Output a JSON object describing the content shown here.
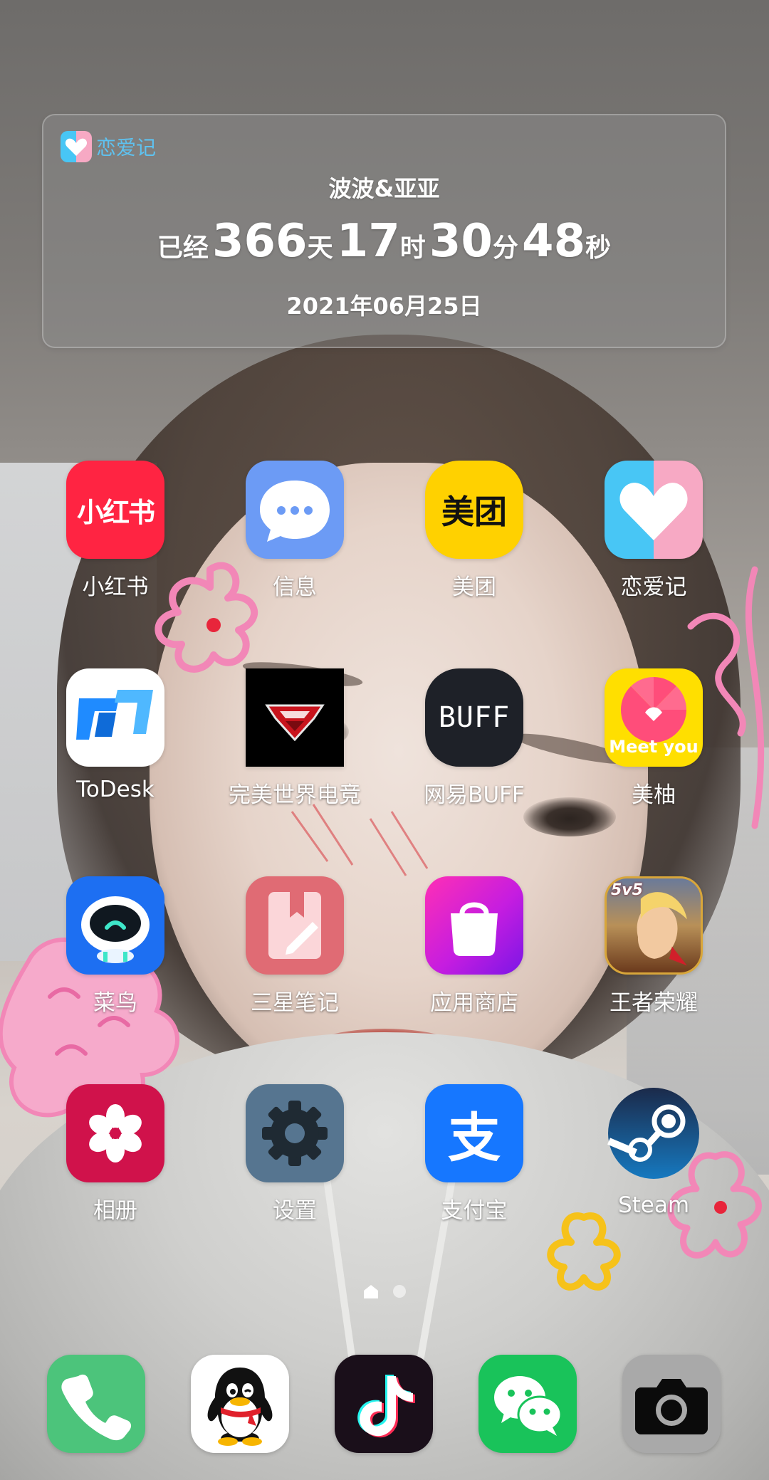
{
  "widget": {
    "app_name": "恋爱记",
    "names": "波波&亚亚",
    "prefix": "已经",
    "days": "366",
    "days_unit": "天",
    "hours": "17",
    "hours_unit": "时",
    "minutes": "30",
    "minutes_unit": "分",
    "seconds": "48",
    "seconds_unit": "秒",
    "date": "2021年06月25日"
  },
  "apps": [
    {
      "label": "小红书",
      "icon_text": "小红书",
      "icon": "xiaohongshu-icon",
      "color": "#ff2442"
    },
    {
      "label": "信息",
      "icon": "messages-icon",
      "color": "#6c9bf5"
    },
    {
      "label": "美团",
      "icon_text": "美团",
      "icon": "meituan-icon",
      "color": "#ffd100"
    },
    {
      "label": "恋爱记",
      "icon": "lianaiji-icon",
      "color": "#48c6f5"
    },
    {
      "label": "ToDesk",
      "icon": "todesk-icon",
      "color": "#1f8bff"
    },
    {
      "label": "完美世界电竞",
      "icon": "perfect-world-esports-icon",
      "color": "#000000"
    },
    {
      "label": "网易BUFF",
      "icon_text": "BUFF",
      "icon": "netease-buff-icon",
      "color": "#1e2128"
    },
    {
      "label": "美柚",
      "icon_text": "Meet you",
      "icon": "meiyou-icon",
      "color": "#ffdf00"
    },
    {
      "label": "菜鸟",
      "icon": "cainiao-icon",
      "color": "#1d6ff2"
    },
    {
      "label": "三星笔记",
      "icon": "samsung-notes-icon",
      "color": "#e06b74"
    },
    {
      "label": "应用商店",
      "icon": "app-store-bag-icon",
      "color": "#d41fd8"
    },
    {
      "label": "王者荣耀",
      "icon_text": "5v5",
      "icon": "honor-of-kings-icon",
      "color": "#c58a3a"
    },
    {
      "label": "相册",
      "icon": "gallery-flower-icon",
      "color": "#d0124b"
    },
    {
      "label": "设置",
      "icon": "settings-gear-icon",
      "color": "#567590"
    },
    {
      "label": "支付宝",
      "icon_text": "支",
      "icon": "alipay-icon",
      "color": "#1677ff"
    },
    {
      "label": "Steam",
      "icon": "steam-icon",
      "color": "#1b2838"
    }
  ],
  "dock": [
    {
      "icon": "phone-icon",
      "color": "#4cc47b"
    },
    {
      "icon": "qq-penguin-icon",
      "color": "#ffffff"
    },
    {
      "icon": "douyin-icon",
      "color": "#1a0f1a"
    },
    {
      "icon": "wechat-icon",
      "color": "#19c35a"
    },
    {
      "icon": "camera-icon",
      "color": "#a9a9a9"
    }
  ],
  "page_indicator": {
    "pages": 2,
    "current": 1
  }
}
